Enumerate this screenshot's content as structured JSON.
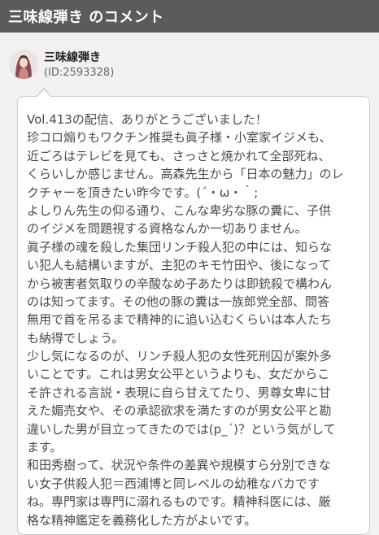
{
  "header": {
    "title": "三味線弾き のコメント"
  },
  "user": {
    "name": "三味線弾き",
    "id": "(ID:2593328)",
    "avatar_icon": "user-avatar-icon"
  },
  "comment": {
    "lines": [
      "Vol.413の配信、ありがとうございました！",
      "珍コロ煽りもワクチン推奨も眞子様・小室家イジメも、",
      "近ごろはテレビを見ても、さっさと焼かれて全部死ね、",
      "くらいしか感じません。高森先生から「日本の魅力」のレ",
      "クチャーを頂きたい昨今です。(´・ω・｀;",
      "よしりん先生の仰る通り、こんな卑劣な豚の糞に、子供",
      "のイジメを問題視する資格なんか一切ありません。",
      "眞子様の魂を殺した集団リンチ殺人犯の中には、知らな",
      "い犯人も結構いますが、主犯のキモ竹田や、後になって",
      "から被害者気取りの辛酸なめ子あたりは即銃殺で構わん",
      "のは知ってます。その他の豚の糞は一族郎党全部、問答",
      "無用で首を吊るまで精神的に追い込むくらいは本人たち",
      "も納得でしょう。",
      "少し気になるのが、リンチ殺人犯の女性死刑囚が案外多",
      "いことです。これは男女公平というよりも、女だからこ",
      "そ許される言説・表現に自ら甘えてたり、男尊女卑に甘",
      "えた媚売女や、その承認欲求を満たすのが男女公平と勘",
      "違いした男が目立ってきたのでは(p_´)？という気がして",
      "ます。",
      "和田秀樹って、状況や条件の差異や規模すら分別できな",
      "い女子供殺人犯＝西浦博と同レベルの幼稚なバカです",
      "ね。専門家は専門に溺れるものです。精神科医には、厳",
      "格な精神鑑定を義務化した方がよいです。"
    ]
  },
  "colors": {
    "header_bg": "#5b5b5b",
    "page_bg": "#f1f1f1",
    "bubble_bg": "#ffffff",
    "text": "#4a4a4a"
  }
}
